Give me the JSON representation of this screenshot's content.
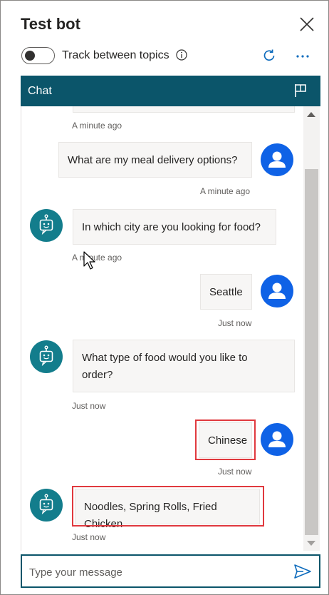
{
  "header": {
    "title": "Test bot",
    "toggle_label": "Track between topics",
    "toggle_on": false
  },
  "chat": {
    "header_label": "Chat",
    "messages": [
      {
        "from": "bot",
        "text": "",
        "time": "A minute ago"
      },
      {
        "from": "user",
        "text": "What are my meal delivery options?",
        "time": "A minute ago"
      },
      {
        "from": "bot",
        "text": "In which city are you looking for food?",
        "time": "A minute ago"
      },
      {
        "from": "user",
        "text": "Seattle",
        "time": "Just now"
      },
      {
        "from": "bot",
        "text": "What type of food would you like to order?",
        "time": "Just now"
      },
      {
        "from": "user",
        "text": "Chinese",
        "time": "Just now"
      },
      {
        "from": "bot",
        "text": "Noodles, Spring Rolls, Fried Chicken",
        "time": "Just now"
      }
    ]
  },
  "input": {
    "placeholder": "Type your message",
    "value": ""
  },
  "colors": {
    "chat_header": "#0b556a",
    "user_avatar": "#0f62e6",
    "bot_avatar": "#137d8c",
    "highlight": "#e0393e"
  },
  "icons": [
    "close-icon",
    "info-icon",
    "refresh-icon",
    "more-icon",
    "flag-icon",
    "user-icon",
    "bot-icon",
    "send-icon"
  ]
}
